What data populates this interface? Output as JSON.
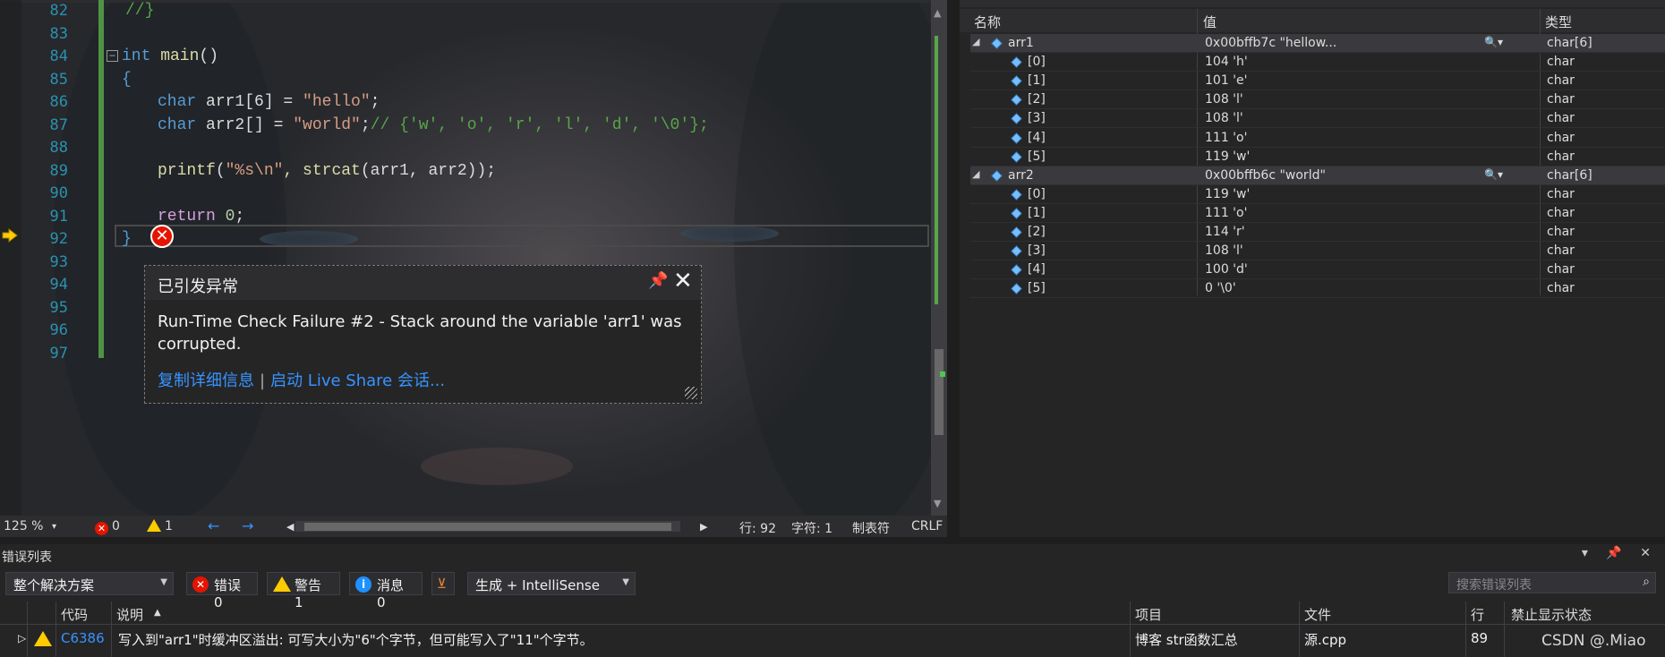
{
  "editor": {
    "line_numbers": [
      "82",
      "83",
      "84",
      "85",
      "86",
      "87",
      "88",
      "89",
      "90",
      "91",
      "92",
      "93",
      "94",
      "95",
      "96",
      "97"
    ],
    "code": {
      "l82": "//}",
      "l84_kw": "int",
      "l84_fn": " main",
      "l84_rest": "()",
      "l85": "{",
      "l86_kw": "char",
      "l86_id": " arr1[6] = ",
      "l86_str": "\"hello\"",
      "l86_end": ";",
      "l87_kw": "char",
      "l87_id": " arr2[] = ",
      "l87_str": "\"world\"",
      "l87_end": ";",
      "l87_cm": "// {'w', 'o', 'r', 'l', 'd', '\\0'};",
      "l89_fn": "printf",
      "l89_p": "(",
      "l89_str": "\"%s\\n\"",
      "l89_fn2": ", strcat",
      "l89_args": "(arr1, arr2));",
      "l91_ctl": "return",
      "l91_num": " 0",
      "l91_end": ";",
      "l92": "}"
    },
    "collapse_glyph": "−",
    "error_glyph": "✕",
    "exception": {
      "title": "已引发异常",
      "message": "Run-Time Check Failure #2 - Stack around the variable 'arr1' was corrupted.",
      "link_copy": "复制详细信息",
      "separator": "|",
      "link_liveshare": "启动 Live Share 会话...",
      "pin_icon": "📌",
      "close_icon": "✕"
    },
    "status": {
      "zoom": "125 %",
      "errors": "0",
      "warnings": "1",
      "nav_back": "←",
      "nav_fwd": "→",
      "line": "行: 92",
      "char": "字符: 1",
      "indent": "制表符",
      "eol": "CRLF"
    }
  },
  "watch": {
    "columns": {
      "name": "名称",
      "value": "值",
      "type": "类型"
    },
    "rows": [
      {
        "name": "arr1",
        "value": "0x00bffb7c \"hellow...",
        "type": "char[6]",
        "expandable": true
      },
      {
        "name": "[0]",
        "value": "104 'h'",
        "type": "char"
      },
      {
        "name": "[1]",
        "value": "101 'e'",
        "type": "char"
      },
      {
        "name": "[2]",
        "value": "108 'l'",
        "type": "char"
      },
      {
        "name": "[3]",
        "value": "108 'l'",
        "type": "char"
      },
      {
        "name": "[4]",
        "value": "111 'o'",
        "type": "char"
      },
      {
        "name": "[5]",
        "value": "119 'w'",
        "type": "char"
      },
      {
        "name": "arr2",
        "value": "0x00bffb6c \"world\"",
        "type": "char[6]",
        "expandable": true
      },
      {
        "name": "[0]",
        "value": "119 'w'",
        "type": "char"
      },
      {
        "name": "[1]",
        "value": "111 'o'",
        "type": "char"
      },
      {
        "name": "[2]",
        "value": "114 'r'",
        "type": "char"
      },
      {
        "name": "[3]",
        "value": "108 'l'",
        "type": "char"
      },
      {
        "name": "[4]",
        "value": "100 'd'",
        "type": "char"
      },
      {
        "name": "[5]",
        "value": "0 '\\0'",
        "type": "char"
      }
    ],
    "expander": "◢",
    "view_icon": "🔍▾"
  },
  "errorlist": {
    "title": "错误列表",
    "window_controls": "▾ 📌 ✕",
    "scope": "整个解决方案",
    "errors_btn": "错误 0",
    "warnings_btn": "警告 1",
    "messages_btn": "消息 0",
    "filter_icon": "⊻",
    "build_filter": "生成 + IntelliSense",
    "search_placeholder": "搜索错误列表",
    "search_icon": "⌕",
    "headers": {
      "code": "代码",
      "desc": "说明",
      "sort": "▲",
      "project": "项目",
      "file": "文件",
      "line": "行",
      "suppress": "禁止显示状态"
    },
    "row": {
      "expander": "▷",
      "code": "C6386",
      "desc": "写入到\"arr1\"时缓冲区溢出: 可写大小为\"6\"个字节，但可能写入了\"11\"个字节。",
      "project": "博客 str函数汇总",
      "file": "源.cpp",
      "line": "89"
    },
    "watermark": "CSDN @.Miao"
  },
  "colors": {
    "accent_link": "#3794ff",
    "error": "#e51400",
    "warning": "#ffcc00",
    "line_number": "#2b91af"
  }
}
